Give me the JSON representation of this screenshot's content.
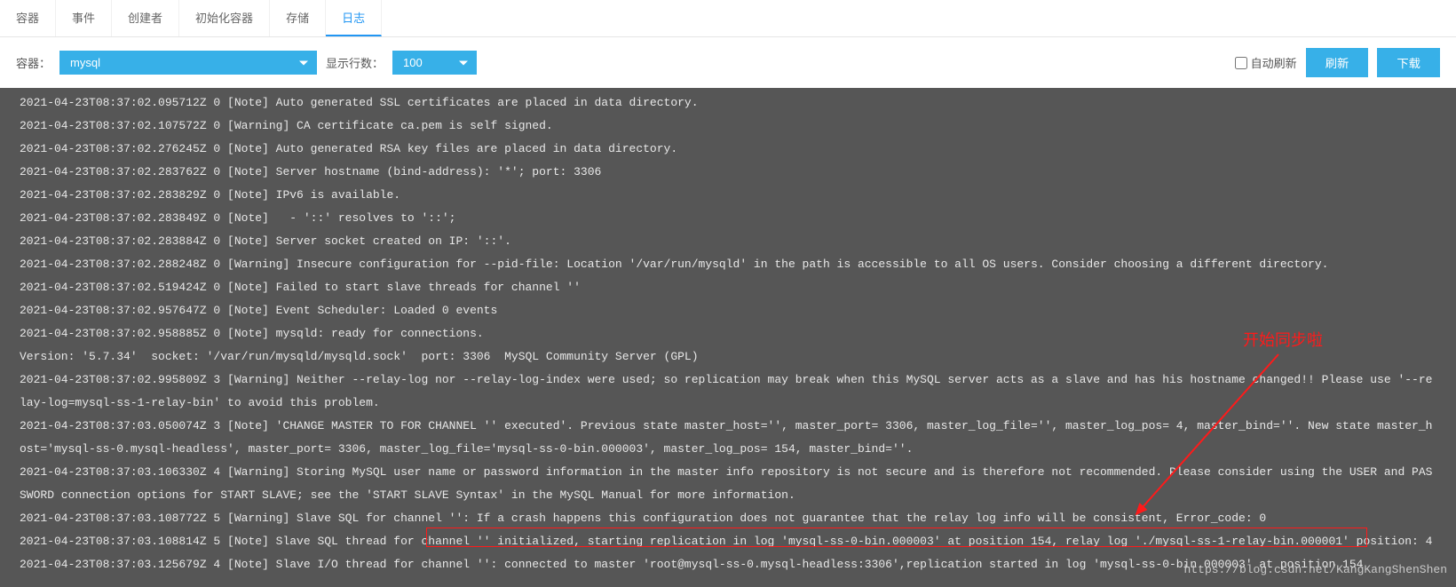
{
  "tabs": [
    "容器",
    "事件",
    "创建者",
    "初始化容器",
    "存储",
    "日志"
  ],
  "active_tab_index": 5,
  "toolbar": {
    "container_label": "容器：",
    "container_value": "mysql",
    "rows_label": "显示行数：",
    "rows_value": "100",
    "auto_refresh_label": "自动刷新",
    "refresh_btn": "刷新",
    "download_btn": "下载"
  },
  "annotation_text": "开始同步啦",
  "watermark": "https://blog.csdn.net/KangKangShenShen",
  "log_lines": [
    "2021-04-23T08:37:02.095712Z 0 [Note] Auto generated SSL certificates are placed in data directory.",
    "2021-04-23T08:37:02.107572Z 0 [Warning] CA certificate ca.pem is self signed.",
    "2021-04-23T08:37:02.276245Z 0 [Note] Auto generated RSA key files are placed in data directory.",
    "2021-04-23T08:37:02.283762Z 0 [Note] Server hostname (bind-address): '*'; port: 3306",
    "2021-04-23T08:37:02.283829Z 0 [Note] IPv6 is available.",
    "2021-04-23T08:37:02.283849Z 0 [Note]   - '::' resolves to '::';",
    "2021-04-23T08:37:02.283884Z 0 [Note] Server socket created on IP: '::'.",
    "2021-04-23T08:37:02.288248Z 0 [Warning] Insecure configuration for --pid-file: Location '/var/run/mysqld' in the path is accessible to all OS users. Consider choosing a different directory.",
    "2021-04-23T08:37:02.519424Z 0 [Note] Failed to start slave threads for channel ''",
    "2021-04-23T08:37:02.957647Z 0 [Note] Event Scheduler: Loaded 0 events",
    "2021-04-23T08:37:02.958885Z 0 [Note] mysqld: ready for connections.",
    "Version: '5.7.34'  socket: '/var/run/mysqld/mysqld.sock'  port: 3306  MySQL Community Server (GPL)",
    "2021-04-23T08:37:02.995809Z 3 [Warning] Neither --relay-log nor --relay-log-index were used; so replication may break when this MySQL server acts as a slave and has his hostname changed!! Please use '--relay-log=mysql-ss-1-relay-bin' to avoid this problem.",
    "2021-04-23T08:37:03.050074Z 3 [Note] 'CHANGE MASTER TO FOR CHANNEL '' executed'. Previous state master_host='', master_port= 3306, master_log_file='', master_log_pos= 4, master_bind=''. New state master_host='mysql-ss-0.mysql-headless', master_port= 3306, master_log_file='mysql-ss-0-bin.000003', master_log_pos= 154, master_bind=''.",
    "2021-04-23T08:37:03.106330Z 4 [Warning] Storing MySQL user name or password information in the master info repository is not secure and is therefore not recommended. Please consider using the USER and PASSWORD connection options for START SLAVE; see the 'START SLAVE Syntax' in the MySQL Manual for more information.",
    "2021-04-23T08:37:03.108772Z 5 [Warning] Slave SQL for channel '': If a crash happens this configuration does not guarantee that the relay log info will be consistent, Error_code: 0",
    "2021-04-23T08:37:03.108814Z 5 [Note] Slave SQL thread for channel '' initialized, starting replication in log 'mysql-ss-0-bin.000003' at position 154, relay log './mysql-ss-1-relay-bin.000001' position: 4",
    "2021-04-23T08:37:03.125679Z 4 [Note] Slave I/O thread for channel '': connected to master 'root@mysql-ss-0.mysql-headless:3306',replication started in log 'mysql-ss-0-bin.000003' at position 154"
  ]
}
